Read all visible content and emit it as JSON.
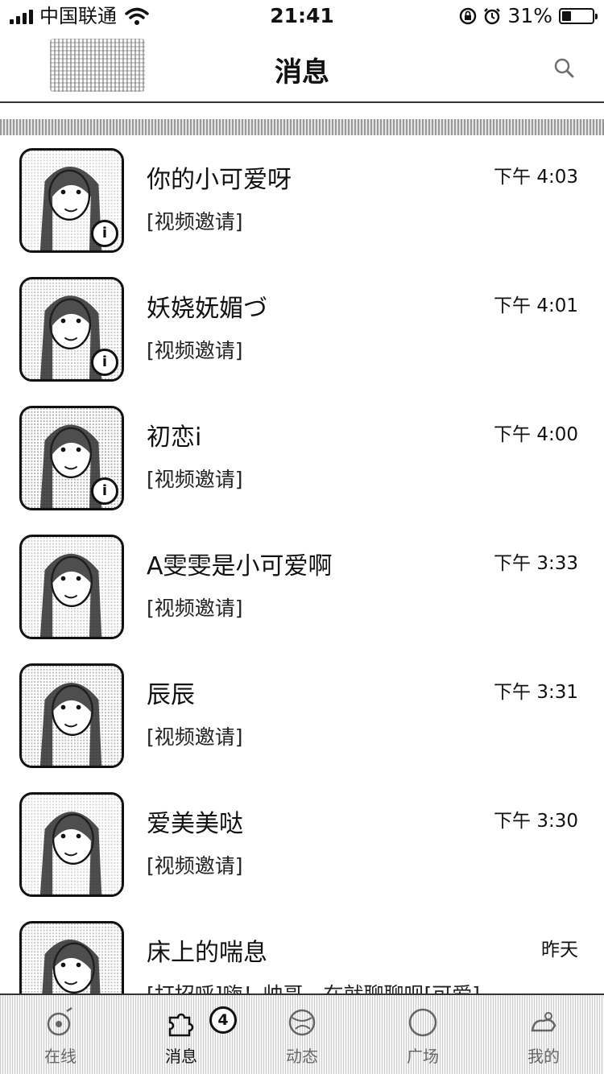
{
  "status_bar": {
    "carrier": "中国联通",
    "time": "21:41",
    "battery_text": "31%",
    "battery_level": 0.31
  },
  "nav": {
    "title": "消息"
  },
  "messages": [
    {
      "name": "你的小可爱呀",
      "time": "下午 4:03",
      "preview": "[视频邀请]",
      "badge": "i"
    },
    {
      "name": "妖娆妩媚づ",
      "time": "下午 4:01",
      "preview": "[视频邀请]",
      "badge": "i"
    },
    {
      "name": "初恋i",
      "time": "下午 4:00",
      "preview": "[视频邀请]",
      "badge": "i"
    },
    {
      "name": "A雯雯是小可爱啊",
      "time": "下午 3:33",
      "preview": "[视频邀请]",
      "badge": ""
    },
    {
      "name": "辰辰",
      "time": "下午 3:31",
      "preview": "[视频邀请]",
      "badge": ""
    },
    {
      "name": "爱美美哒",
      "time": "下午 3:30",
      "preview": "[视频邀请]",
      "badge": ""
    },
    {
      "name": "床上的喘息",
      "time": "昨天",
      "preview": "[打招呼]嗨！帅哥，在就聊聊呗[可爱]",
      "badge": ""
    }
  ],
  "tab_bar": {
    "tabs": [
      {
        "label": "在线",
        "icon": "online-icon"
      },
      {
        "label": "消息",
        "icon": "message-icon",
        "badge": "4"
      },
      {
        "label": "动态",
        "icon": "feed-icon"
      },
      {
        "label": "广场",
        "icon": "square-icon"
      },
      {
        "label": "我的",
        "icon": "profile-icon"
      }
    ]
  }
}
